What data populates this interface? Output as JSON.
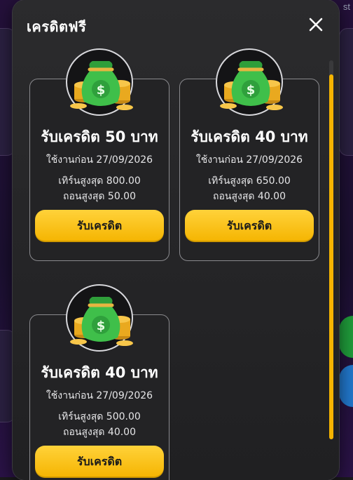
{
  "modal": {
    "title": "เครดิตฟรี"
  },
  "background": {
    "partial_text": "st"
  },
  "cards": [
    {
      "title": "รับเครดิต 50 บาท",
      "expiry": "ใช้งานก่อน 27/09/2026",
      "max_win": "เทิร์นสูงสุด 800.00",
      "max_withdraw": "ถอนสูงสุด 50.00",
      "button_label": "รับเครดิต"
    },
    {
      "title": "รับเครดิต 40 บาท",
      "expiry": "ใช้งานก่อน 27/09/2026",
      "max_win": "เทิร์นสูงสุด 650.00",
      "max_withdraw": "ถอนสูงสุด 40.00",
      "button_label": "รับเครดิต"
    },
    {
      "title": "รับเครดิต 40 บาท",
      "expiry": "ใช้งานก่อน 27/09/2026",
      "max_win": "เทิร์นสูงสุด 500.00",
      "max_withdraw": "ถอนสูงสุด 40.00",
      "button_label": "รับเครดิต"
    }
  ],
  "icons": {
    "close": "close-icon",
    "bag": "money-bag-icon"
  },
  "colors": {
    "accent": "#f5b400",
    "modal_bg": "#232325",
    "bag_green": "#3fbf4a",
    "coin_gold": "#f3b323"
  }
}
